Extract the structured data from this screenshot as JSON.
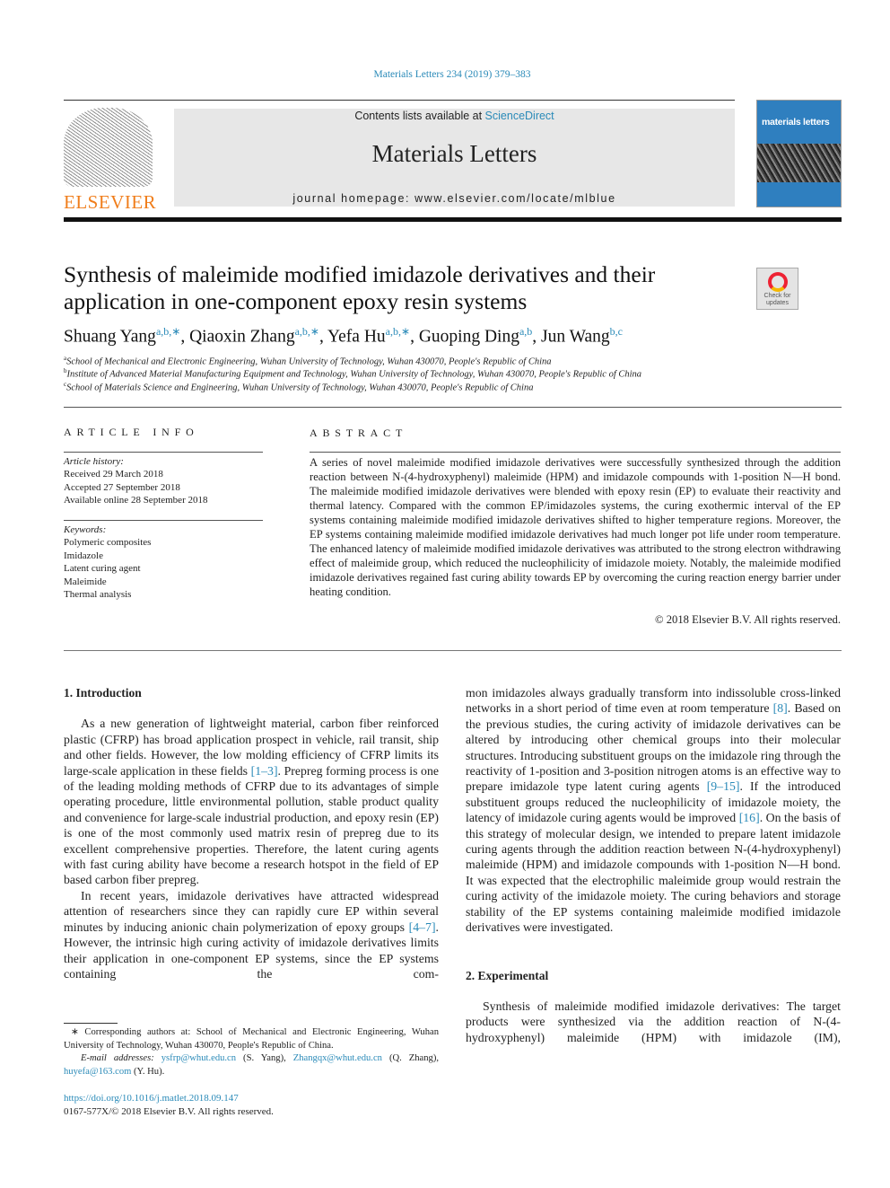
{
  "header": {
    "citation": "Materials Letters 234 (2019) 379–383",
    "contents_prefix": "Contents lists available at ",
    "contents_link": "ScienceDirect",
    "journal_title": "Materials Letters",
    "homepage": "journal homepage: www.elsevier.com/locate/mlblue",
    "publisher_logo": "ELSEVIER",
    "cover_title": "materials letters",
    "colors": {
      "link": "#2a8ab8",
      "elsevier": "#f07e1c",
      "box": "#e7e7e7"
    }
  },
  "article": {
    "title": "Synthesis of maleimide modified imidazole derivatives and their application in one-component epoxy resin systems",
    "check_updates": [
      "Check for",
      "updates"
    ],
    "authors": [
      {
        "name": "Shuang Yang",
        "aff": "a,b,∗",
        "sep": ", "
      },
      {
        "name": "Qiaoxin Zhang",
        "aff": "a,b,∗",
        "sep": ", "
      },
      {
        "name": "Yefa Hu",
        "aff": "a,b,∗",
        "sep": ", "
      },
      {
        "name": "Guoping Ding",
        "aff": "a,b",
        "sep": ", "
      },
      {
        "name": "Jun Wang",
        "aff": "b,c",
        "sep": ""
      }
    ],
    "affiliations": [
      {
        "mark": "a",
        "text": "School of Mechanical and Electronic Engineering, Wuhan University of Technology, Wuhan 430070, People's Republic of China"
      },
      {
        "mark": "b",
        "text": "Institute of Advanced Material Manufacturing Equipment and Technology, Wuhan University of Technology, Wuhan 430070, People's Republic of China"
      },
      {
        "mark": "c",
        "text": "School of Materials Science and Engineering, Wuhan University of Technology, Wuhan 430070, People's Republic of China"
      }
    ]
  },
  "info": {
    "heading": "ARTICLE INFO",
    "history_label": "Article history:",
    "history": [
      "Received 29 March 2018",
      "Accepted 27 September 2018",
      "Available online 28 September 2018"
    ],
    "keywords_label": "Keywords:",
    "keywords": [
      "Polymeric composites",
      "Imidazole",
      "Latent curing agent",
      "Maleimide",
      "Thermal analysis"
    ]
  },
  "abstract": {
    "heading": "ABSTRACT",
    "text": "A series of novel maleimide modified imidazole derivatives were successfully synthesized through the addition reaction between N-(4-hydroxyphenyl) maleimide (HPM) and imidazole compounds with 1-position N—H bond. The maleimide modified imidazole derivatives were blended with epoxy resin (EP) to evaluate their reactivity and thermal latency. Compared with the common EP/imidazoles systems, the curing exothermic interval of the EP systems containing maleimide modified imidazole derivatives shifted to higher temperature regions. Moreover, the EP systems containing maleimide modified imidazole derivatives had much longer pot life under room temperature. The enhanced latency of maleimide modified imidazole derivatives was attributed to the strong electron withdrawing effect of maleimide group, which reduced the nucleophilicity of imidazole moiety. Notably, the maleimide modified imidazole derivatives regained fast curing ability towards EP by overcoming the curing reaction energy barrier under heating condition.",
    "copyright": "© 2018 Elsevier B.V. All rights reserved."
  },
  "body": {
    "intro_heading": "1. Introduction",
    "intro_p1": [
      "As a new generation of lightweight material, carbon fiber reinforced plastic (CFRP) has broad application prospect in vehicle, rail transit, ship and other fields. However, the low molding efficiency of CFRP limits its large-scale application in these fields ",
      {
        "ref": "[1–3]"
      },
      ". Prepreg forming process is one of the leading molding methods of CFRP due to its advantages of simple operating procedure, little environmental pollution, stable product quality and convenience for large-scale industrial production, and epoxy resin (EP) is one of the most commonly used matrix resin of prepreg due to its excellent comprehensive properties. Therefore, the latent curing agents with fast curing ability have become a research hotspot in the field of EP based carbon fiber prepreg."
    ],
    "intro_p2_left": [
      "In recent years, imidazole derivatives have attracted widespread attention of researchers since they can rapidly cure EP within several minutes by inducing anionic chain polymerization of epoxy groups ",
      {
        "ref": "[4–7]"
      },
      ". However, the intrinsic high curing activity of imidazole derivatives limits their application in one-component EP systems, since the EP systems containing the com-"
    ],
    "intro_p2_right": [
      "mon imidazoles always gradually transform into indissoluble cross-linked networks in a short period of time even at room temperature ",
      {
        "ref": "[8]"
      },
      ". Based on the previous studies, the curing activity of imidazole derivatives can be altered by introducing other chemical groups into their molecular structures. Introducing substituent groups on the imidazole ring through the reactivity of 1-position and 3-position nitrogen atoms is an effective way to prepare imidazole type latent curing agents ",
      {
        "ref": "[9–15]"
      },
      ". If the introduced substituent groups reduced the nucleophilicity of imidazole moiety, the latency of imidazole curing agents would be improved ",
      {
        "ref": "[16]"
      },
      ". On the basis of this strategy of molecular design, we intended to prepare latent imidazole curing agents through the addition reaction between N-(4-hydroxyphenyl) maleimide (HPM) and imidazole compounds with 1-position N—H bond. It was expected that the electrophilic maleimide group would restrain the curing activity of the imidazole moiety. The curing behaviors and storage stability of the EP systems containing maleimide modified imidazole derivatives were investigated."
    ],
    "exp_heading": "2. Experimental",
    "exp_p1": [
      "Synthesis of maleimide modified imidazole derivatives: The target products were synthesized via the addition reaction of N-(4-hydroxyphenyl) maleimide (HPM) with imidazole (IM),"
    ]
  },
  "footnotes": {
    "corresponding": "∗ Corresponding authors at: School of Mechanical and Electronic Engineering, Wuhan University of Technology, Wuhan 430070, People's Republic of China.",
    "email_label": "E-mail addresses:",
    "emails": [
      {
        "addr": "ysfrp@whut.edu.cn",
        "who": " (S. Yang), "
      },
      {
        "addr": "Zhangqx@whut.edu.cn",
        "who": " (Q. Zhang), "
      },
      {
        "addr": "huyefa@163.com",
        "who": " (Y. Hu)."
      }
    ],
    "doi": "https://doi.org/10.1016/j.matlet.2018.09.147",
    "issn": "0167-577X/© 2018 Elsevier B.V. All rights reserved."
  }
}
